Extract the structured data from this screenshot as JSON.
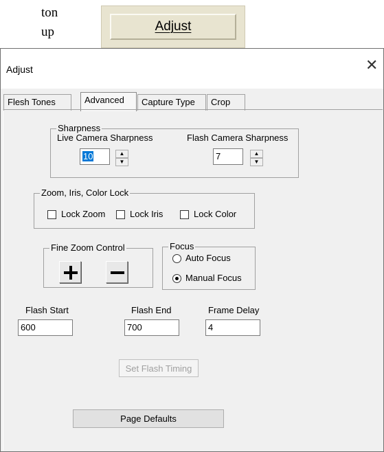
{
  "doc": {
    "text_line1": "ton",
    "text_line2": "up"
  },
  "adjust_button": {
    "label": "Adjust"
  },
  "dialog": {
    "title": "Adjust",
    "close_glyph": "✕",
    "tabs": [
      "Flesh Tones",
      "Advanced",
      "Capture Type",
      "Crop"
    ],
    "active_tab": "Advanced",
    "sharpness": {
      "group_label": "Sharpness",
      "live_label": "Live Camera Sharpness",
      "live_value": "10",
      "flash_label": "Flash Camera Sharpness",
      "flash_value": "7",
      "spin_up": "▲",
      "spin_down": "▼"
    },
    "lock_group": {
      "label": "Zoom, Iris, Color Lock",
      "lock_zoom": "Lock Zoom",
      "lock_iris": "Lock Iris",
      "lock_color": "Lock Color"
    },
    "fine_zoom": {
      "label": "Fine Zoom Control"
    },
    "focus": {
      "label": "Focus",
      "auto": "Auto Focus",
      "manual": "Manual Focus",
      "selected": "Manual Focus"
    },
    "flash_start": {
      "label": "Flash Start",
      "value": "600"
    },
    "flash_end": {
      "label": "Flash End",
      "value": "700"
    },
    "frame_delay": {
      "label": "Frame Delay",
      "value": "4"
    },
    "set_flash_timing": "Set Flash Timing",
    "page_defaults": "Page Defaults"
  }
}
